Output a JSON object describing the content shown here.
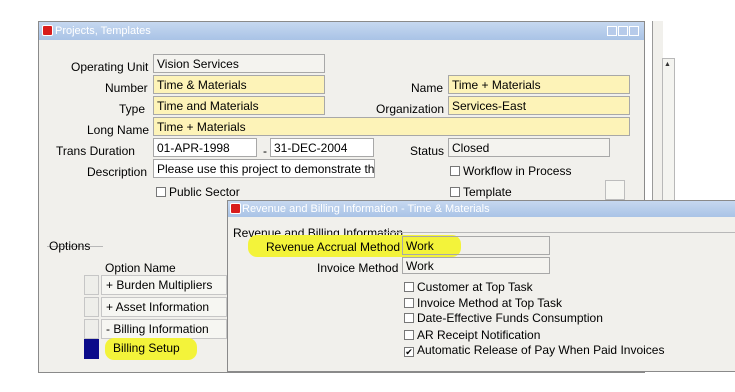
{
  "main_window": {
    "title": "Projects, Templates",
    "fields": {
      "operating_unit": {
        "label": "Operating Unit",
        "value": "Vision Services"
      },
      "number": {
        "label": "Number",
        "value": "Time &  Materials"
      },
      "name": {
        "label": "Name",
        "value": "Time +  Materials"
      },
      "type": {
        "label": "Type",
        "value": "Time and Materials"
      },
      "organization": {
        "label": "Organization",
        "value": "Services-East"
      },
      "long_name": {
        "label": "Long Name",
        "value": "Time +  Materials"
      },
      "trans_duration": {
        "label": "Trans Duration",
        "start": "01-APR-1998",
        "separator": "-",
        "end": "31-DEC-2004"
      },
      "status": {
        "label": "Status",
        "value": "Closed"
      },
      "description": {
        "label": "Description",
        "value": "Please use this project to demonstrate the"
      }
    },
    "checkboxes": {
      "workflow": "Workflow in Process",
      "public_sector": "Public Sector",
      "template": "Template"
    },
    "options": {
      "heading": "Options",
      "column_header": "Option Name",
      "items": [
        {
          "label": "+ Burden Multipliers"
        },
        {
          "label": "+ Asset Information"
        },
        {
          "label": "- Billing Information"
        },
        {
          "label": "Billing Setup"
        }
      ]
    }
  },
  "dialog": {
    "title": "Revenue and Billing Information - Time &  Materials",
    "section": "Revenue and Billing Information",
    "revenue_accrual_method": {
      "label": "Revenue Accrual Method",
      "value": "Work"
    },
    "invoice_method": {
      "label": "Invoice Method",
      "value": "Work"
    },
    "checkboxes": [
      {
        "label": "Customer at Top Task",
        "checked": false
      },
      {
        "label": "Invoice Method at Top Task",
        "checked": false
      },
      {
        "label": "Date-Effective Funds Consumption",
        "checked": false
      },
      {
        "label": "AR Receipt Notification",
        "checked": false
      },
      {
        "label": "Automatic Release of Pay When Paid Invoices",
        "checked": true
      }
    ]
  },
  "colors": {
    "required_field": "#fdf3b8",
    "highlight": "#f3f33a",
    "title_bar": "#a9c3e6",
    "selected_node": "#0b0b8a"
  }
}
